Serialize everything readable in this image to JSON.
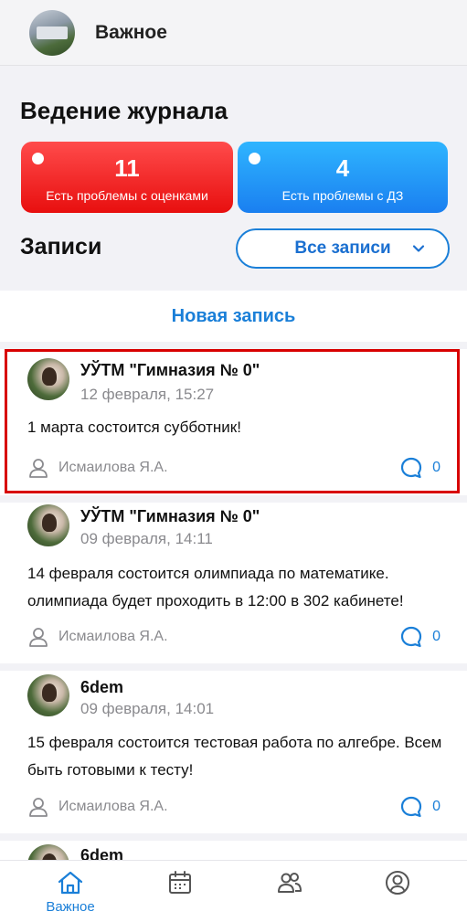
{
  "header": {
    "title": "Важное"
  },
  "journal": {
    "title": "Ведение журнала",
    "cards": [
      {
        "count": "11",
        "label": "Есть проблемы с оценками",
        "color": "#e80f0f"
      },
      {
        "count": "4",
        "label": "Есть проблемы с ДЗ",
        "color": "#1a7ff0"
      }
    ]
  },
  "records": {
    "title": "Записи",
    "filter_value": "Все записи",
    "new_post_label": "Новая запись"
  },
  "posts": [
    {
      "author": "УЎТМ \"Гимназия № 0\"",
      "date": "12 февраля, 15:27",
      "text": "1 марта состоится субботник!",
      "signer": "Исмаилова Я.А.",
      "comments": "0"
    },
    {
      "author": "УЎТМ \"Гимназия № 0\"",
      "date": "09 февраля, 14:11",
      "text": "14 февраля состоится олимпиада по математике. олимпиада будет проходить в 12:00 в 302 кабинете!",
      "signer": "Исмаилова Я.А.",
      "comments": "0"
    },
    {
      "author": "6dem",
      "date": "09 февраля, 14:01",
      "text": "15 февраля состоится тестовая работа по алгебре. Всем быть готовыми к тесту!",
      "signer": "Исмаилова Я.А.",
      "comments": "0"
    },
    {
      "author": "6dem"
    }
  ],
  "bottom_nav": {
    "items": [
      {
        "icon": "home-icon",
        "label": "Важное",
        "active": true
      },
      {
        "icon": "calendar-icon"
      },
      {
        "icon": "people-icon"
      },
      {
        "icon": "profile-icon"
      }
    ],
    "accent": "#1a7fd8",
    "inactive": "#555555"
  }
}
